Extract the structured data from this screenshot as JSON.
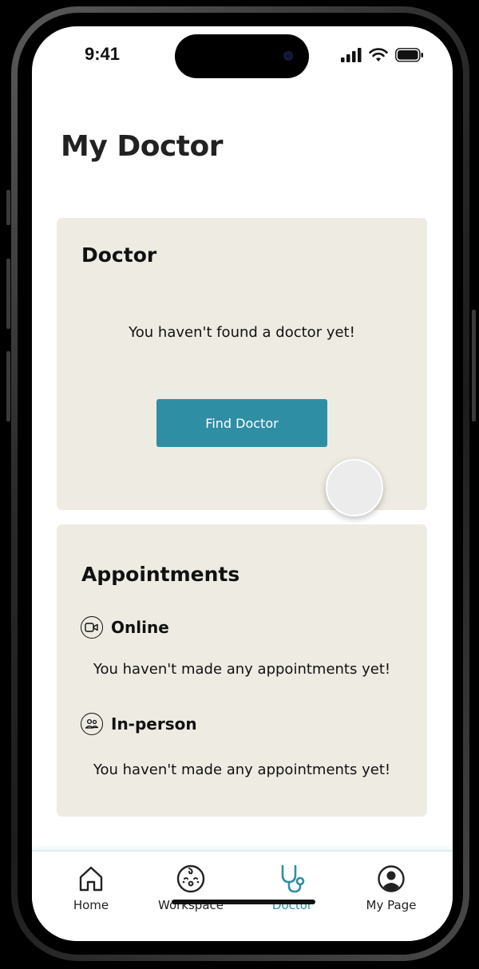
{
  "status_bar": {
    "time": "9:41"
  },
  "page": {
    "title": "My Doctor"
  },
  "doctor_card": {
    "title": "Doctor",
    "empty_message": "You haven't found a doctor yet!",
    "find_button_label": "Find Doctor"
  },
  "appointments_card": {
    "title": "Appointments",
    "sections": [
      {
        "label": "Online",
        "icon": "video-camera-icon",
        "empty_message": "You haven't made any appointments yet!"
      },
      {
        "label": "In-person",
        "icon": "people-icon",
        "empty_message": "You haven't made any appointments yet!"
      }
    ]
  },
  "tab_bar": {
    "active_color": "#2e8ea4",
    "tabs": [
      {
        "label": "Home",
        "icon": "home-icon",
        "active": false
      },
      {
        "label": "Workspace",
        "icon": "baby-face-icon",
        "active": false
      },
      {
        "label": "Doctor",
        "icon": "stethoscope-icon",
        "active": true
      },
      {
        "label": "My Page",
        "icon": "user-circle-icon",
        "active": false
      }
    ]
  },
  "colors": {
    "card_background": "#eeebe2",
    "accent": "#2e8ea4",
    "text": "#111111"
  }
}
